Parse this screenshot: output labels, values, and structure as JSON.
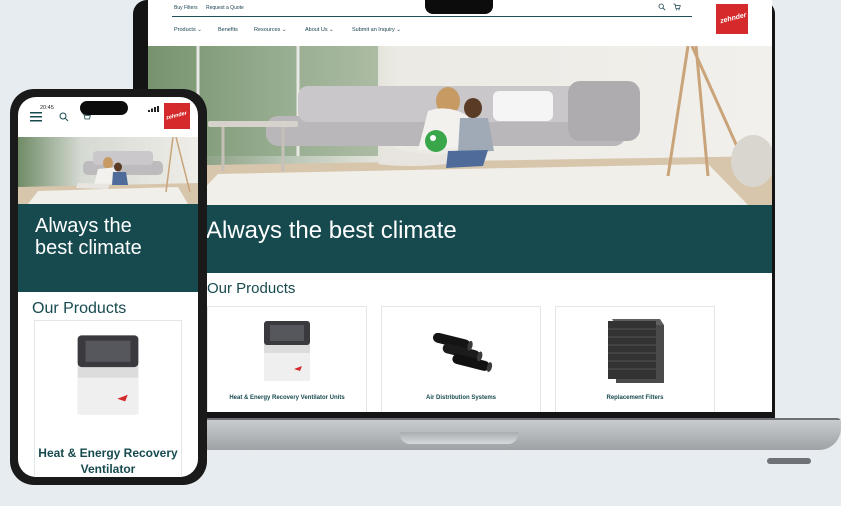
{
  "site": {
    "top_links": [
      "Buy Filters",
      "Request a Quote"
    ],
    "nav": [
      "Products ⌄",
      "Benefits",
      "Resources ⌄",
      "About Us ⌄",
      "Submit an Inquiry ⌄"
    ],
    "logo_text": "zehnder",
    "hero_headline": "Always the best climate",
    "products_title": "Our Products",
    "products": [
      {
        "label": "Heat & Energy Recovery Ventilator Units"
      },
      {
        "label": "Air Distribution Systems"
      },
      {
        "label": "Replacement Filters"
      }
    ]
  },
  "phone": {
    "status_time": "20:45",
    "headline": "Always the best climate",
    "products_title": "Our Products",
    "first_product": "Heat & Energy Recovery Ventilator"
  },
  "colors": {
    "brand_red": "#d42a2c",
    "teal": "#174a4f"
  }
}
